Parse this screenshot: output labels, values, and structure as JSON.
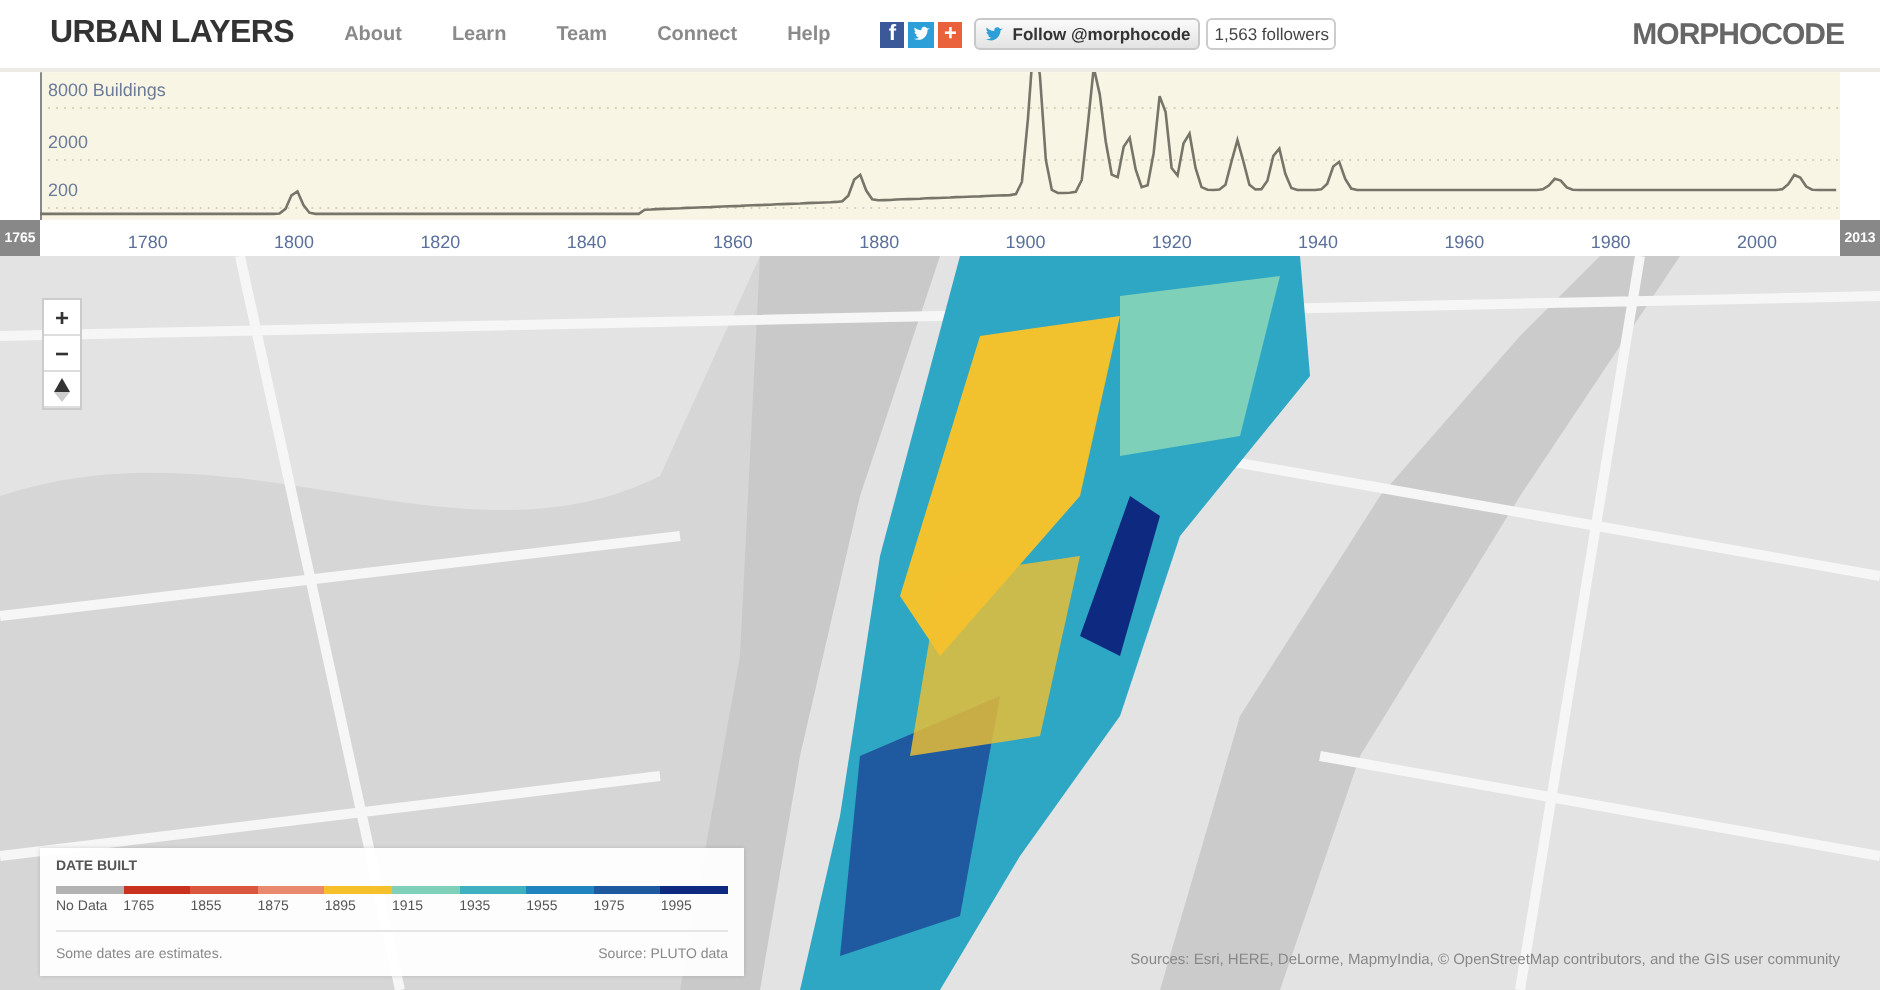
{
  "brand": "URBAN LAYERS",
  "nav": [
    {
      "label": "About"
    },
    {
      "label": "Learn"
    },
    {
      "label": "Team"
    },
    {
      "label": "Connect"
    },
    {
      "label": "Help"
    }
  ],
  "share_icons": [
    {
      "kind": "facebook",
      "glyph": "f"
    },
    {
      "kind": "twitter"
    },
    {
      "kind": "plus",
      "glyph": "+"
    }
  ],
  "follow_button": "Follow @morphocode",
  "followers": "1,563 followers",
  "logo": "MORPHOCODE",
  "timeline": {
    "y_labels": [
      "8000 Buildings",
      "2000",
      "200"
    ],
    "x_labels": [
      "1780",
      "1800",
      "1820",
      "1840",
      "1860",
      "1880",
      "1900",
      "1920",
      "1940",
      "1960",
      "1980",
      "2000"
    ],
    "start_handle": "1765",
    "end_handle": "2013"
  },
  "map_controls": [
    {
      "kind": "text",
      "label": "+"
    },
    {
      "kind": "text",
      "label": "−"
    },
    {
      "kind": "north"
    }
  ],
  "legend": {
    "title": "DATE BUILT",
    "items": [
      {
        "label": "No Data",
        "color": "#b3b3b3"
      },
      {
        "label": "1765",
        "color": "#c8321e"
      },
      {
        "label": "1855",
        "color": "#d9573f"
      },
      {
        "label": "1875",
        "color": "#e98a6e"
      },
      {
        "label": "1895",
        "color": "#f5c02a"
      },
      {
        "label": "1915",
        "color": "#7fd0b8"
      },
      {
        "label": "1935",
        "color": "#3fb0c0"
      },
      {
        "label": "1955",
        "color": "#1f84c0"
      },
      {
        "label": "1975",
        "color": "#1f5aa0"
      },
      {
        "label": "1995",
        "color": "#0d2a80"
      }
    ],
    "note": "Some dates are estimates.",
    "source": "Source: PLUTO data"
  },
  "attribution": "Sources: Esri, HERE, DeLorme, MapmyIndia, © OpenStreetMap contributors, and the GIS user community"
}
